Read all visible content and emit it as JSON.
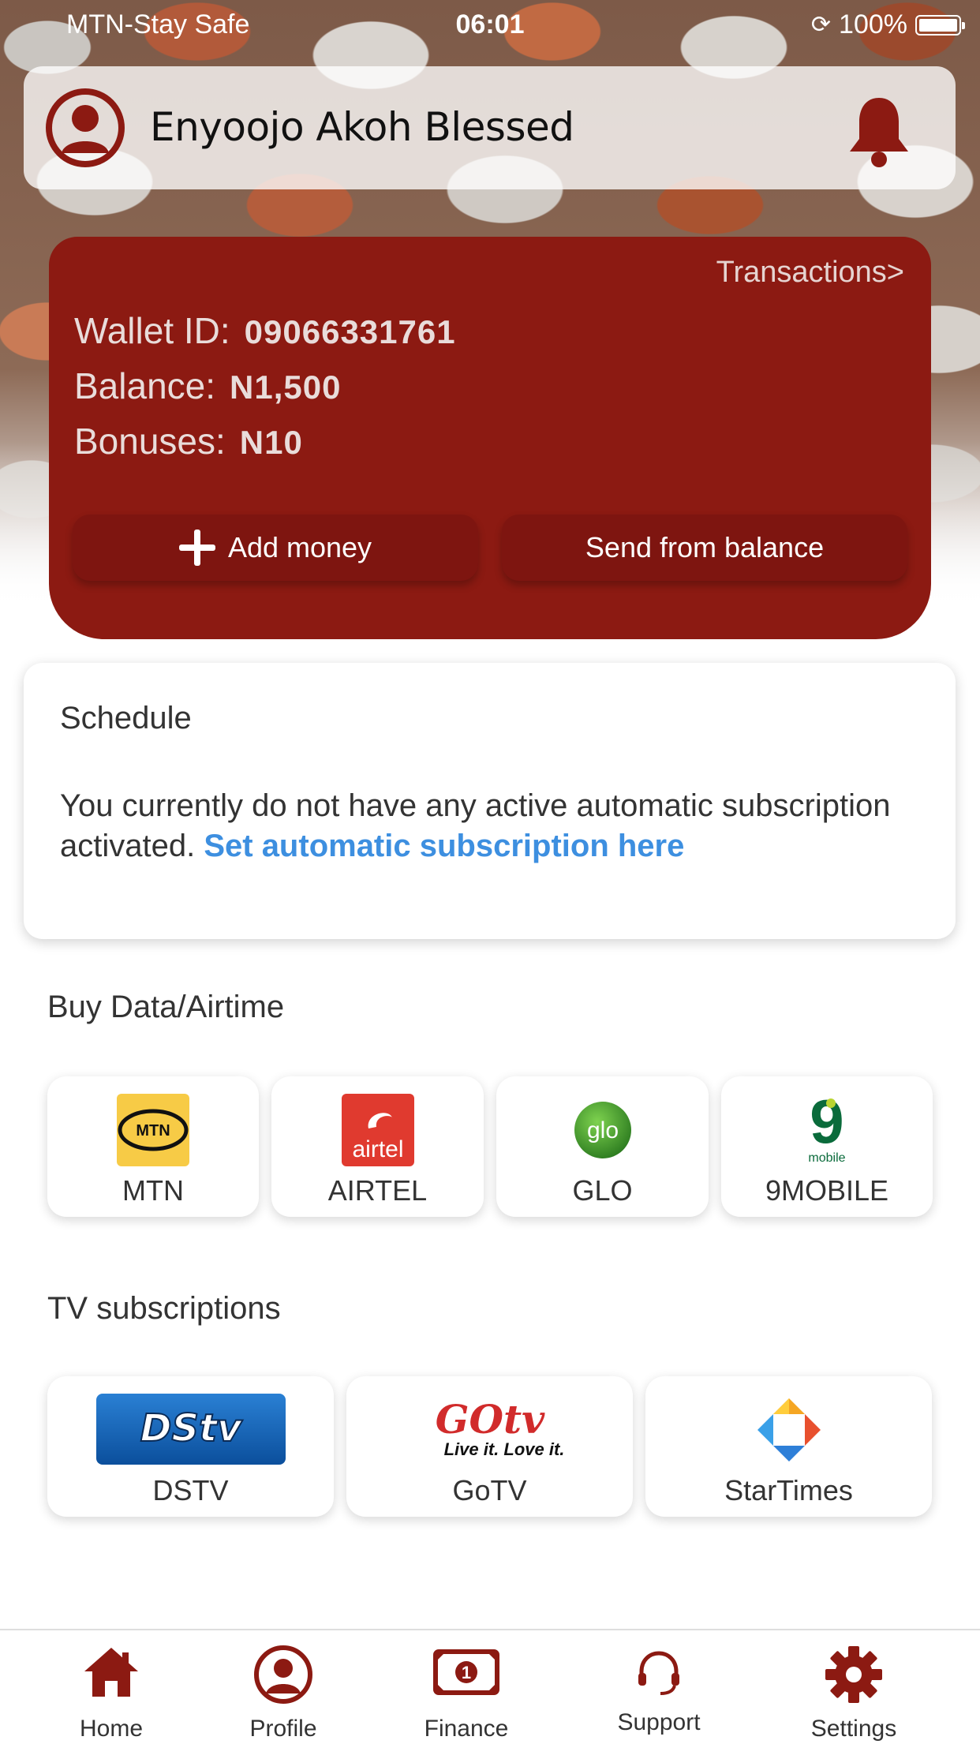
{
  "status_bar": {
    "carrier": "MTN-Stay Safe",
    "time": "06:01",
    "battery": "100%"
  },
  "header": {
    "user_name": "Enyoojo Akoh Blessed",
    "icons": [
      "user-avatar-icon",
      "bell-icon"
    ]
  },
  "wallet": {
    "transactions_link": "Transactions>",
    "wallet_id_label": "Wallet ID:",
    "wallet_id_value": "09066331761",
    "balance_label": "Balance:",
    "balance_value": "N1,500",
    "bonuses_label": "Bonuses:",
    "bonuses_value": "N10",
    "add_money_label": "Add money",
    "send_label": "Send from balance"
  },
  "schedule": {
    "title": "Schedule",
    "text": "You currently do not have any active automatic subscription activated. ",
    "link": "Set automatic subscription here"
  },
  "data_airtime": {
    "title": "Buy Data/Airtime",
    "providers": [
      {
        "label": "MTN",
        "logo_text": "MTN"
      },
      {
        "label": "AIRTEL",
        "logo_text": "airtel"
      },
      {
        "label": "GLO",
        "logo_text": "glo"
      },
      {
        "label": "9MOBILE",
        "logo_text": "9",
        "logo_sub": "mobile"
      }
    ]
  },
  "tv": {
    "title": "TV subscriptions",
    "providers": [
      {
        "label": "DSTV",
        "logo_text": "DStv"
      },
      {
        "label": "GoTV",
        "logo_text": "GOtv",
        "logo_tagline": "Live it. Love it."
      },
      {
        "label": "StarTimes"
      }
    ]
  },
  "nav": {
    "items": [
      {
        "label": "Home",
        "icon": "home-icon"
      },
      {
        "label": "Profile",
        "icon": "profile-icon"
      },
      {
        "label": "Finance",
        "icon": "finance-icon"
      },
      {
        "label": "Support",
        "icon": "headset-icon"
      },
      {
        "label": "Settings",
        "icon": "gear-icon"
      }
    ]
  },
  "colors": {
    "brand_red": "#8c1a12",
    "link_blue": "#3d8fe0"
  }
}
